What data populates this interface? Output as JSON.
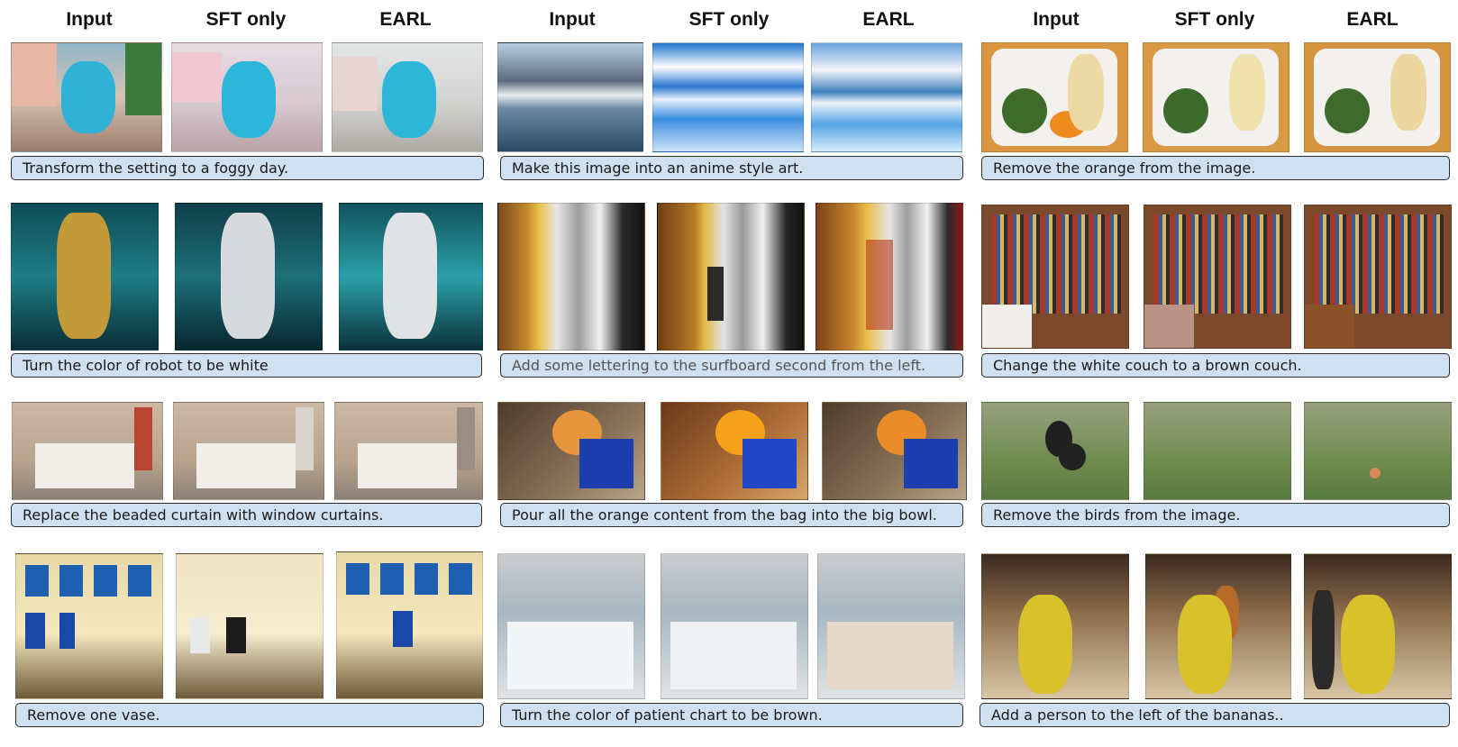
{
  "columns": [
    {
      "headers": [
        "Input",
        "SFT only",
        "EARL"
      ]
    },
    {
      "headers": [
        "Input",
        "SFT only",
        "EARL"
      ]
    },
    {
      "headers": [
        "Input",
        "SFT only",
        "EARL"
      ]
    }
  ],
  "rows": [
    {
      "captions": [
        "Transform the setting to a foggy day.",
        "Make this image into an anime style art.",
        "Remove the orange from the image."
      ]
    },
    {
      "captions": [
        "Turn the color of robot to be white",
        "Add some lettering to the surfboard second from the left.",
        "Change the white couch to a brown couch."
      ]
    },
    {
      "captions": [
        "Replace the beaded curtain with window curtains.",
        "Pour all the orange content from the bag into the big bowl.",
        "Remove the birds from the image."
      ]
    },
    {
      "captions": [
        "Remove one vase.",
        "Turn the color of patient chart to be brown.",
        "Add a person to the left of the bananas.."
      ]
    }
  ],
  "image_names": [
    [
      "monster-input",
      "monster-sft",
      "monster-earl",
      "mountains-input",
      "mountains-sft",
      "mountains-earl",
      "plate-input",
      "plate-sft",
      "plate-earl"
    ],
    [
      "robot-input",
      "robot-sft",
      "robot-earl",
      "surfboards-input",
      "surfboards-sft",
      "surfboards-earl",
      "living-room-input",
      "living-room-sft",
      "living-room-earl"
    ],
    [
      "bedroom-input",
      "bedroom-sft",
      "bedroom-earl",
      "bowl-input",
      "bowl-sft",
      "bowl-earl",
      "birds-input",
      "birds-sft",
      "birds-earl"
    ],
    [
      "vases-input",
      "vases-sft",
      "vases-earl",
      "patient-chart-input",
      "patient-chart-sft",
      "patient-chart-earl",
      "bananas-input",
      "bananas-sft",
      "bananas-earl"
    ]
  ]
}
